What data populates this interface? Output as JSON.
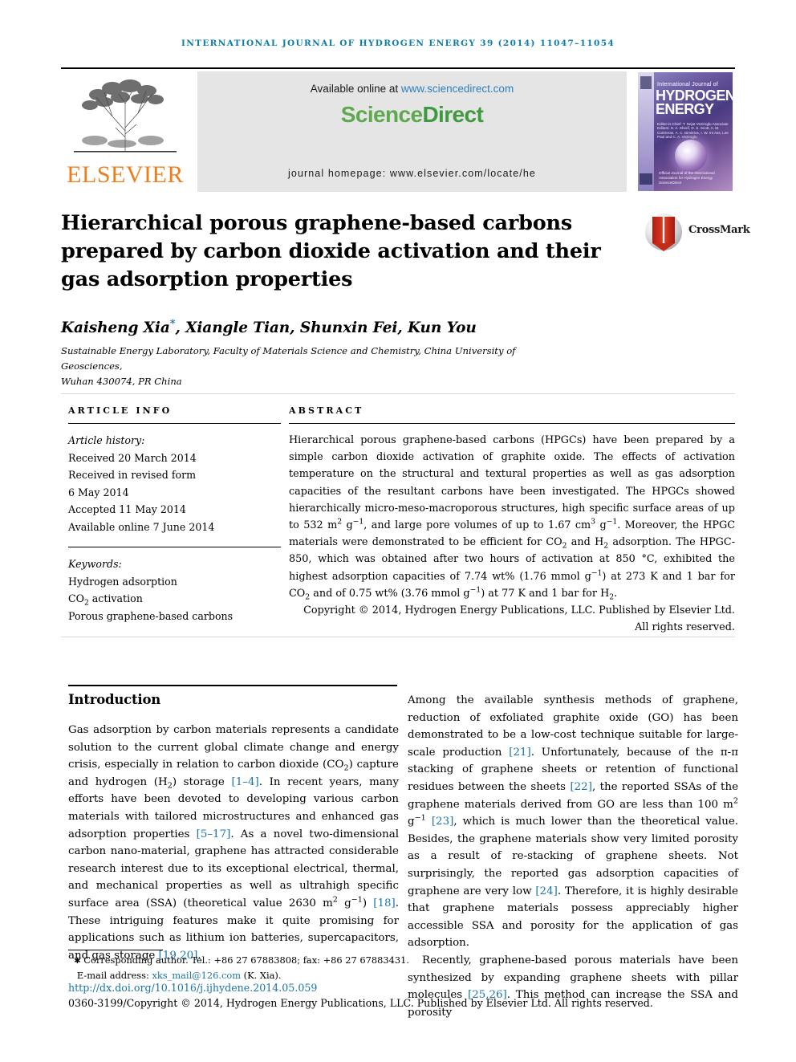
{
  "running_head": "INTERNATIONAL JOURNAL OF HYDROGEN ENERGY 39 (2014) 11047–11054",
  "masthead": {
    "publisher_name": "ELSEVIER",
    "available_prefix": "Available online at ",
    "available_url": "www.sciencedirect.com",
    "sciencedirect_part1": "Science",
    "sciencedirect_part2": "Direct",
    "journal_homepage": "journal homepage: www.elsevier.com/locate/he",
    "cover": {
      "small_line": "International Journal of",
      "big_line1": "HYDROGEN",
      "big_line2": "ENERGY",
      "editors": "Editor-in-Chief:  T. Nejat Veziroglu\nAssociate Editors:  S. A. Sherif, D. S. Scott, A. M. Contreras, A. C. Dimitrios, I. W. Int Ass, Lee Paul  and C. A. Veziroglu",
      "bottom_text": "Official Journal of the International Association for Hydrogen Energy\nScienceDirect"
    }
  },
  "article": {
    "title": "Hierarchical porous graphene-based carbons prepared by carbon dioxide activation and their gas adsorption properties",
    "crossmark_label": "CrossMark",
    "authors": "Kaisheng Xia, Xiangle Tian, Shunxin Fei, Kun You",
    "author_marker": "*",
    "affiliation_line1": "Sustainable Energy Laboratory, Faculty of Materials Science and Chemistry, China University of Geosciences,",
    "affiliation_line2": "Wuhan 430074, PR China"
  },
  "article_info": {
    "heading": "ARTICLE INFO",
    "history_label": "Article history:",
    "history": [
      "Received 20 March 2014",
      "Received in revised form",
      "6 May 2014",
      "Accepted 11 May 2014",
      "Available online 7 June 2014"
    ],
    "keywords_label": "Keywords:",
    "keywords": [
      "Hydrogen adsorption",
      "CO2 activation",
      "Porous graphene-based carbons"
    ]
  },
  "abstract": {
    "heading": "ABSTRACT",
    "body": "Hierarchical porous graphene-based carbons (HPGCs) have been prepared by a simple carbon dioxide activation of graphite oxide. The effects of activation temperature on the structural and textural properties as well as gas adsorption capacities of the resultant carbons have been investigated. The HPGCs showed hierarchically micro-meso-macroporous structures, high specific surface areas of up to 532 m2 g−1, and large pore volumes of up to 1.67 cm3 g−1. Moreover, the HPGC materials were demonstrated to be efficient for CO2 and H2 adsorption. The HPGC-850, which was obtained after two hours of activation at 850 °C, exhibited the highest adsorption capacities of 7.74 wt% (1.76 mmol g−1) at 273 K and 1 bar for CO2 and of 0.75 wt% (3.76 mmol g−1) at 77 K and 1 bar for H2.",
    "copyright": "Copyright © 2014, Hydrogen Energy Publications, LLC. Published by Elsevier Ltd. All rights reserved."
  },
  "body": {
    "intro_heading": "Introduction",
    "left_paragraphs": [
      "Gas adsorption by carbon materials represents a candidate solution to the current global climate change and energy crisis, especially in relation to carbon dioxide (CO2) capture and hydrogen (H2) storage [1–4]. In recent years, many efforts have been devoted to developing various carbon materials with tailored microstructures and enhanced gas adsorption properties [5–17]. As a novel two-dimensional carbon nanomaterial, graphene has attracted considerable research interest due to its exceptional electrical, thermal, and mechanical properties as well as ultrahigh specific surface area (SSA) (theoretical value 2630 m2 g−1) [18]. These intriguing features make it quite promising for applications such as lithium ion batteries, supercapacitors, and gas storage [19,20]."
    ],
    "right_paragraphs": [
      "Among the available synthesis methods of graphene, reduction of exfoliated graphite oxide (GO) has been demonstrated to be a low-cost technique suitable for large-scale production [21]. Unfortunately, because of the π-π stacking of graphene sheets or retention of functional residues between the sheets [22], the reported SSAs of the graphene materials derived from GO are less than 100 m2 g−1 [23], which is much lower than the theoretical value. Besides, the graphene materials show very limited porosity as a result of re-stacking of graphene sheets. Not surprisingly, the reported gas adsorption capacities of graphene are very low [24]. Therefore, it is highly desirable that graphene materials possess appreciably higher accessible SSA and porosity for the application of gas adsorption.",
      "Recently, graphene-based porous materials have been synthesized by expanding graphene sheets with pillar molecules [25,26]. This method can increase the SSA and porosity"
    ]
  },
  "footer": {
    "corresponding": "Corresponding author. Tel.: +86 27 67883808; fax: +86 27 67883431.",
    "email_label": "E-mail address: ",
    "email": "xks_mail@126.com",
    "email_suffix": " (K. Xia).",
    "doi": "http://dx.doi.org/10.1016/j.ijhydene.2014.05.059",
    "issn_line": "0360-3199/Copyright © 2014, Hydrogen Energy Publications, LLC. Published by Elsevier Ltd. All rights reserved."
  },
  "colors": {
    "running_head": "#0a7ea8",
    "link": "#1a74a8",
    "elsevier_orange": "#ef7d1a",
    "sciencedirect_green": "#3f9a3f",
    "panel_gray": "#e5e5e5"
  }
}
